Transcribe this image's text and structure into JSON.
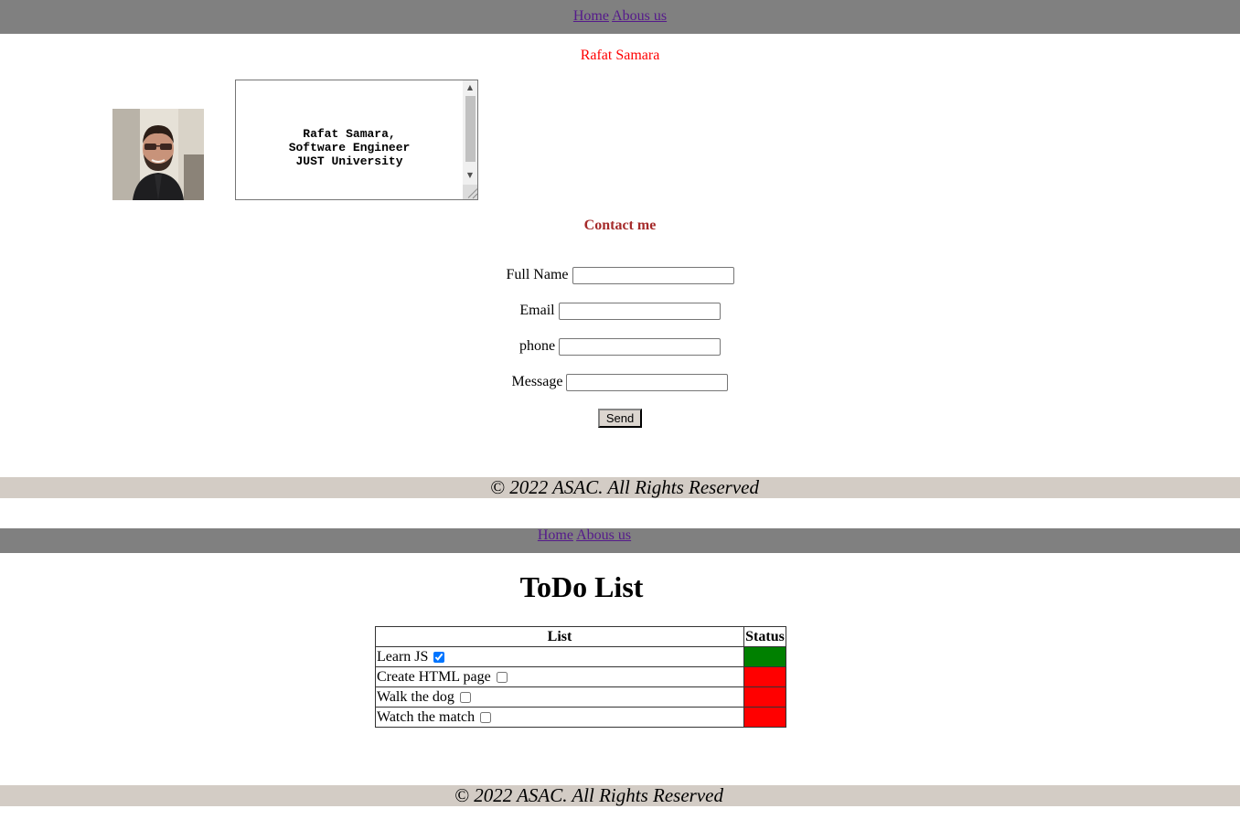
{
  "nav_top": {
    "links": [
      "Home",
      "Abous us"
    ]
  },
  "profile": {
    "name": "Rafat Samara",
    "bio": "Rafat Samara,\nSoftware Engineer\nJUST University",
    "photo_icon": "profile-photo"
  },
  "contact": {
    "heading": "Contact me",
    "fields": [
      {
        "label": "Full Name",
        "value": ""
      },
      {
        "label": "Email",
        "value": ""
      },
      {
        "label": "phone",
        "value": ""
      },
      {
        "label": "Message",
        "value": ""
      }
    ],
    "send_label": "Send"
  },
  "footer_top": {
    "text": "© 2022 ASAC. All Rights Reserved"
  },
  "nav_bottom": {
    "links": [
      "Home",
      "Abous us"
    ]
  },
  "todo": {
    "title": "ToDo List",
    "headers": [
      "List",
      "Status"
    ],
    "items": [
      {
        "label": "Learn JS",
        "checked": true,
        "status_color": "#008000"
      },
      {
        "label": "Create HTML page",
        "checked": false,
        "status_color": "#ff0000"
      },
      {
        "label": "Walk the dog",
        "checked": false,
        "status_color": "#ff0000"
      },
      {
        "label": "Watch the match",
        "checked": false,
        "status_color": "#ff0000"
      }
    ]
  },
  "footer_bottom": {
    "text": "© 2022 ASAC. All Rights Reserved"
  },
  "colors": {
    "nav_bg": "#808080",
    "footer_bg": "#d3ccc5",
    "name_color": "#ff0000",
    "contact_heading_color": "#a52a2a"
  }
}
